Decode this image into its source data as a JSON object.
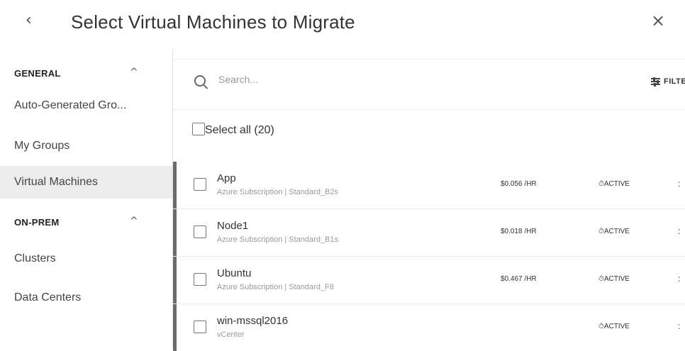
{
  "header": {
    "back_icon": "‹",
    "title": "Select Virtual Machines to Migrate",
    "close_icon": "×"
  },
  "sidebar": {
    "sections": [
      {
        "label": "GENERAL",
        "items": [
          "Auto-Generated Gro...",
          "My Groups",
          "Virtual Machines"
        ]
      },
      {
        "label": "ON-PREM",
        "items": [
          "Clusters",
          "Data Centers"
        ]
      }
    ],
    "active_item": "Virtual Machines",
    "caret_icon": "^"
  },
  "main": {
    "search": {
      "placeholder": "Search...",
      "value": ""
    },
    "filter_label": "FILTER",
    "select_all_label": "Select all (20)",
    "rows": [
      {
        "name": "App",
        "sub": "Azure Subscription | Standard_B2s",
        "price": "$0.056 /HR",
        "status": "ACTIVE",
        "status_icon": "clock-icon"
      },
      {
        "name": "Node1",
        "sub": "Azure Subscription | Standard_B1s",
        "price": "$0.018 /HR",
        "status": "ACTIVE",
        "status_icon": "clock-icon"
      },
      {
        "name": "Ubuntu",
        "sub": "Azure Subscription | Standard_F8",
        "price": "$0.467 /HR",
        "status": "ACTIVE",
        "status_icon": "clock-icon"
      },
      {
        "name": "win-mssql2016",
        "sub": "vCenter",
        "price": "",
        "status": "ACTIVE",
        "status_icon": "clock-icon"
      }
    ]
  },
  "colors": {
    "active_bg": "#ececec",
    "row_marker": "#6b6b6b"
  }
}
